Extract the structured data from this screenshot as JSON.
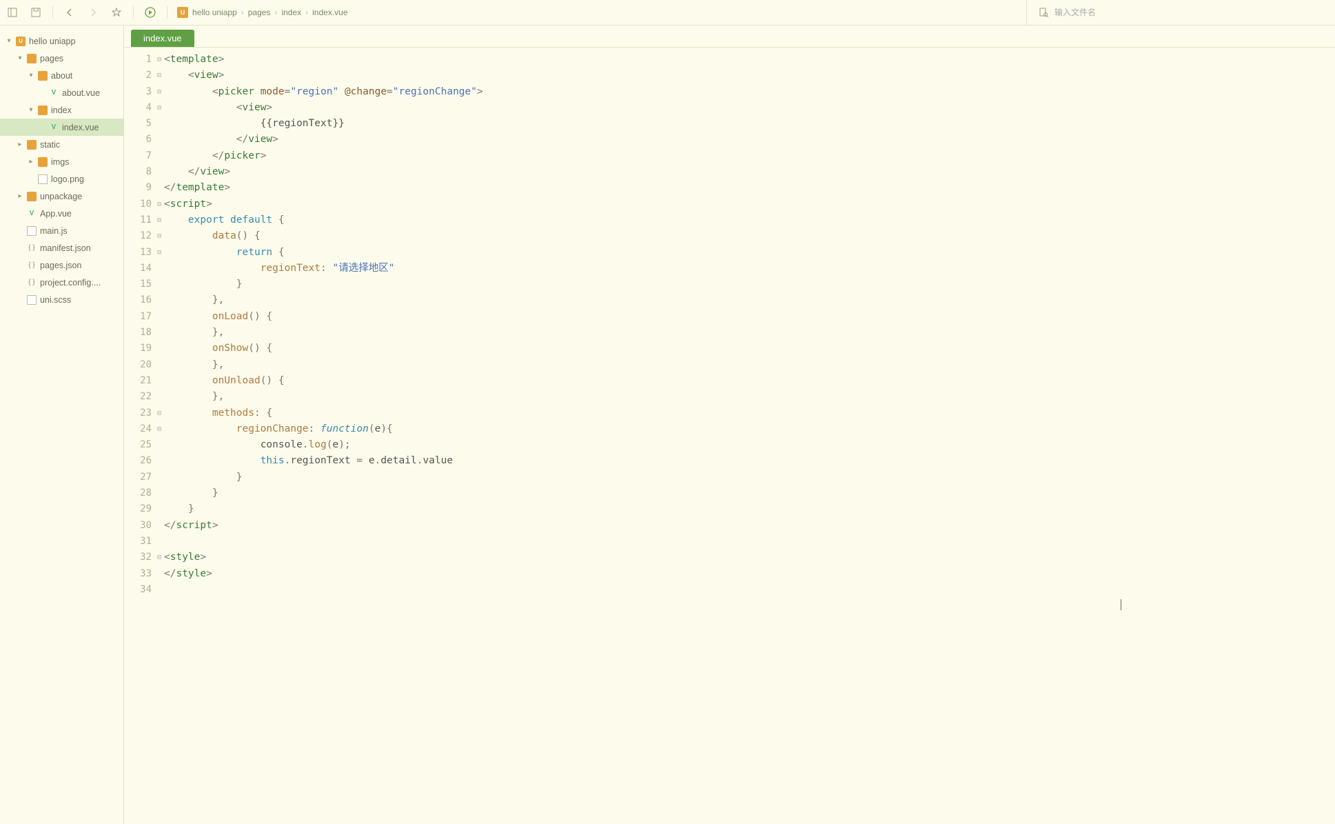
{
  "toolbar": {
    "breadcrumb": [
      "hello uniapp",
      "pages",
      "index",
      "index.vue"
    ],
    "search_placeholder": "输入文件名"
  },
  "tree": [
    {
      "depth": 0,
      "twist": "▾",
      "icon": "proj",
      "label": "hello uniapp",
      "sel": false
    },
    {
      "depth": 1,
      "twist": "▾",
      "icon": "folder-open",
      "label": "pages",
      "sel": false
    },
    {
      "depth": 2,
      "twist": "▾",
      "icon": "folder-open",
      "label": "about",
      "sel": false
    },
    {
      "depth": 3,
      "twist": "",
      "icon": "vue",
      "label": "about.vue",
      "sel": false
    },
    {
      "depth": 2,
      "twist": "▾",
      "icon": "folder-open",
      "label": "index",
      "sel": false
    },
    {
      "depth": 3,
      "twist": "",
      "icon": "vue",
      "label": "index.vue",
      "sel": true
    },
    {
      "depth": 1,
      "twist": "▸",
      "icon": "folder",
      "label": "static",
      "sel": false
    },
    {
      "depth": 2,
      "twist": "▸",
      "icon": "folder",
      "label": "imgs",
      "sel": false
    },
    {
      "depth": 2,
      "twist": "",
      "icon": "img",
      "label": "logo.png",
      "sel": false
    },
    {
      "depth": 1,
      "twist": "▸",
      "icon": "folder",
      "label": "unpackage",
      "sel": false
    },
    {
      "depth": 1,
      "twist": "",
      "icon": "vue",
      "label": "App.vue",
      "sel": false
    },
    {
      "depth": 1,
      "twist": "",
      "icon": "file",
      "label": "main.js",
      "sel": false
    },
    {
      "depth": 1,
      "twist": "",
      "icon": "json",
      "label": "manifest.json",
      "sel": false
    },
    {
      "depth": 1,
      "twist": "",
      "icon": "json",
      "label": "pages.json",
      "sel": false
    },
    {
      "depth": 1,
      "twist": "",
      "icon": "json",
      "label": "project.config....",
      "sel": false
    },
    {
      "depth": 1,
      "twist": "",
      "icon": "file",
      "label": "uni.scss",
      "sel": false
    }
  ],
  "tabs": [
    {
      "label": "index.vue",
      "active": true
    }
  ],
  "code": {
    "lineCount": 34,
    "foldMarks": {
      "1": "⊟",
      "2": "⊟",
      "3": "⊟",
      "4": "⊟",
      "10": "⊟",
      "11": "⊟",
      "12": "⊟",
      "13": "⊟",
      "23": "⊟",
      "24": "⊟",
      "32": "⊟"
    },
    "lines": [
      [
        {
          "c": "t-punc",
          "t": "<"
        },
        {
          "c": "t-tag",
          "t": "template"
        },
        {
          "c": "t-punc",
          "t": ">"
        }
      ],
      [
        {
          "c": "",
          "t": "    "
        },
        {
          "c": "t-punc",
          "t": "<"
        },
        {
          "c": "t-tag",
          "t": "view"
        },
        {
          "c": "t-punc",
          "t": ">"
        }
      ],
      [
        {
          "c": "",
          "t": "        "
        },
        {
          "c": "t-punc",
          "t": "<"
        },
        {
          "c": "t-tag",
          "t": "picker"
        },
        {
          "c": "",
          "t": " "
        },
        {
          "c": "t-attr",
          "t": "mode"
        },
        {
          "c": "t-punc",
          "t": "="
        },
        {
          "c": "t-str",
          "t": "\"region\""
        },
        {
          "c": "",
          "t": " "
        },
        {
          "c": "t-evt",
          "t": "@change"
        },
        {
          "c": "t-punc",
          "t": "="
        },
        {
          "c": "t-str",
          "t": "\"regionChange\""
        },
        {
          "c": "t-punc",
          "t": ">"
        }
      ],
      [
        {
          "c": "",
          "t": "            "
        },
        {
          "c": "t-punc",
          "t": "<"
        },
        {
          "c": "t-tag",
          "t": "view"
        },
        {
          "c": "t-punc",
          "t": ">"
        }
      ],
      [
        {
          "c": "",
          "t": "                "
        },
        {
          "c": "t-id",
          "t": "{{regionText}}"
        }
      ],
      [
        {
          "c": "",
          "t": "            "
        },
        {
          "c": "t-punc",
          "t": "</"
        },
        {
          "c": "t-tag",
          "t": "view"
        },
        {
          "c": "t-punc",
          "t": ">"
        }
      ],
      [
        {
          "c": "",
          "t": "        "
        },
        {
          "c": "t-punc",
          "t": "</"
        },
        {
          "c": "t-tag",
          "t": "picker"
        },
        {
          "c": "t-punc",
          "t": ">"
        }
      ],
      [
        {
          "c": "",
          "t": "    "
        },
        {
          "c": "t-punc",
          "t": "</"
        },
        {
          "c": "t-tag",
          "t": "view"
        },
        {
          "c": "t-punc",
          "t": ">"
        }
      ],
      [
        {
          "c": "t-punc",
          "t": "</"
        },
        {
          "c": "t-tag",
          "t": "template"
        },
        {
          "c": "t-punc",
          "t": ">"
        }
      ],
      [
        {
          "c": "t-punc",
          "t": "<"
        },
        {
          "c": "t-tag",
          "t": "script"
        },
        {
          "c": "t-punc",
          "t": ">"
        }
      ],
      [
        {
          "c": "",
          "t": "    "
        },
        {
          "c": "t-kw",
          "t": "export"
        },
        {
          "c": "",
          "t": " "
        },
        {
          "c": "t-kw",
          "t": "default"
        },
        {
          "c": "",
          "t": " "
        },
        {
          "c": "t-punc",
          "t": "{"
        }
      ],
      [
        {
          "c": "",
          "t": "        "
        },
        {
          "c": "t-fn",
          "t": "data"
        },
        {
          "c": "t-punc",
          "t": "()"
        },
        {
          "c": "",
          "t": " "
        },
        {
          "c": "t-punc",
          "t": "{"
        }
      ],
      [
        {
          "c": "",
          "t": "            "
        },
        {
          "c": "t-kw",
          "t": "return"
        },
        {
          "c": "",
          "t": " "
        },
        {
          "c": "t-punc",
          "t": "{"
        }
      ],
      [
        {
          "c": "",
          "t": "                "
        },
        {
          "c": "t-prop",
          "t": "regionText"
        },
        {
          "c": "t-punc",
          "t": ":"
        },
        {
          "c": "",
          "t": " "
        },
        {
          "c": "t-str",
          "t": "\"请选择地区\""
        }
      ],
      [
        {
          "c": "",
          "t": "            "
        },
        {
          "c": "t-punc",
          "t": "}"
        }
      ],
      [
        {
          "c": "",
          "t": "        "
        },
        {
          "c": "t-punc",
          "t": "},"
        }
      ],
      [
        {
          "c": "",
          "t": "        "
        },
        {
          "c": "t-fn",
          "t": "onLoad"
        },
        {
          "c": "t-punc",
          "t": "()"
        },
        {
          "c": "",
          "t": " "
        },
        {
          "c": "t-punc",
          "t": "{"
        }
      ],
      [
        {
          "c": "",
          "t": "        "
        },
        {
          "c": "t-punc",
          "t": "},"
        }
      ],
      [
        {
          "c": "",
          "t": "        "
        },
        {
          "c": "t-fn",
          "t": "onShow"
        },
        {
          "c": "t-punc",
          "t": "()"
        },
        {
          "c": "",
          "t": " "
        },
        {
          "c": "t-punc",
          "t": "{"
        }
      ],
      [
        {
          "c": "",
          "t": "        "
        },
        {
          "c": "t-punc",
          "t": "},"
        }
      ],
      [
        {
          "c": "",
          "t": "        "
        },
        {
          "c": "t-fn",
          "t": "onUnload"
        },
        {
          "c": "t-punc",
          "t": "()"
        },
        {
          "c": "",
          "t": " "
        },
        {
          "c": "t-punc",
          "t": "{"
        }
      ],
      [
        {
          "c": "",
          "t": "        "
        },
        {
          "c": "t-punc",
          "t": "},"
        }
      ],
      [
        {
          "c": "",
          "t": "        "
        },
        {
          "c": "t-prop",
          "t": "methods"
        },
        {
          "c": "t-punc",
          "t": ":"
        },
        {
          "c": "",
          "t": " "
        },
        {
          "c": "t-punc",
          "t": "{"
        }
      ],
      [
        {
          "c": "",
          "t": "            "
        },
        {
          "c": "t-prop",
          "t": "regionChange"
        },
        {
          "c": "t-punc",
          "t": ":"
        },
        {
          "c": "",
          "t": " "
        },
        {
          "c": "t-kw2",
          "t": "function"
        },
        {
          "c": "t-punc",
          "t": "("
        },
        {
          "c": "t-id",
          "t": "e"
        },
        {
          "c": "t-punc",
          "t": "){"
        }
      ],
      [
        {
          "c": "",
          "t": "                "
        },
        {
          "c": "t-id",
          "t": "console"
        },
        {
          "c": "t-punc",
          "t": "."
        },
        {
          "c": "t-fn",
          "t": "log"
        },
        {
          "c": "t-punc",
          "t": "("
        },
        {
          "c": "t-id",
          "t": "e"
        },
        {
          "c": "t-punc",
          "t": ");"
        }
      ],
      [
        {
          "c": "",
          "t": "                "
        },
        {
          "c": "t-kw",
          "t": "this"
        },
        {
          "c": "t-punc",
          "t": "."
        },
        {
          "c": "t-id",
          "t": "regionText"
        },
        {
          "c": "",
          "t": " "
        },
        {
          "c": "t-punc",
          "t": "="
        },
        {
          "c": "",
          "t": " "
        },
        {
          "c": "t-id",
          "t": "e"
        },
        {
          "c": "t-punc",
          "t": "."
        },
        {
          "c": "t-id",
          "t": "detail"
        },
        {
          "c": "t-punc",
          "t": "."
        },
        {
          "c": "t-id",
          "t": "value"
        }
      ],
      [
        {
          "c": "",
          "t": "            "
        },
        {
          "c": "t-punc",
          "t": "}"
        }
      ],
      [
        {
          "c": "",
          "t": "        "
        },
        {
          "c": "t-punc",
          "t": "}"
        }
      ],
      [
        {
          "c": "",
          "t": "    "
        },
        {
          "c": "t-punc",
          "t": "}"
        }
      ],
      [
        {
          "c": "t-punc",
          "t": "</"
        },
        {
          "c": "t-tag",
          "t": "script"
        },
        {
          "c": "t-punc",
          "t": ">"
        }
      ],
      [],
      [
        {
          "c": "t-punc",
          "t": "<"
        },
        {
          "c": "t-tag",
          "t": "style"
        },
        {
          "c": "t-punc",
          "t": ">"
        }
      ],
      [
        {
          "c": "t-punc",
          "t": "</"
        },
        {
          "c": "t-tag",
          "t": "style"
        },
        {
          "c": "t-punc",
          "t": ">"
        }
      ],
      []
    ]
  }
}
